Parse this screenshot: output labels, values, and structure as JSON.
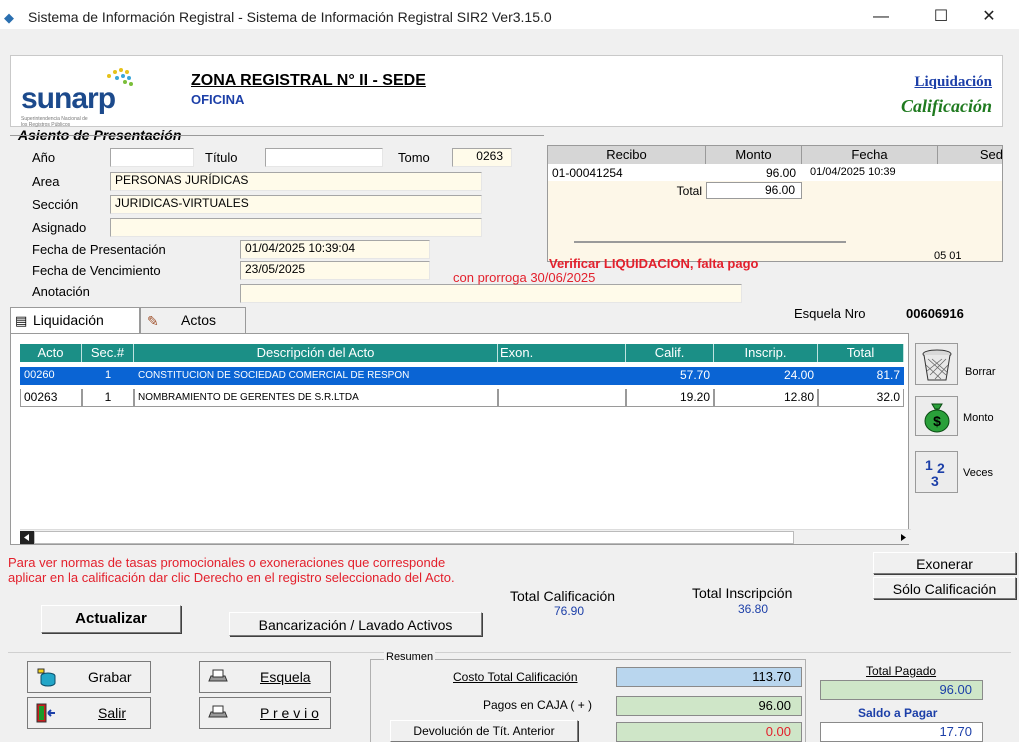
{
  "window": {
    "title": "Sistema de Información Registral - Sistema de Información Registral SIR2  Ver3.15.0",
    "minimize": "—",
    "maximize": "☐",
    "close": "✕"
  },
  "header": {
    "logo": "sunarp",
    "logo_sub": "Superintendencia Nacional de los Registros Públicos",
    "zona": "ZONA REGISTRAL N° II - SEDE",
    "oficina": "OFICINA",
    "liquidacion": "Liquidación",
    "calificacion": "Calificación"
  },
  "asiento": {
    "title": "Asiento de Presentación",
    "anio_label": "Año",
    "anio_value": "",
    "titulo_label": "Título",
    "titulo_value": "",
    "tomo_label": "Tomo",
    "tomo_value": "0263",
    "area_label": "Area",
    "area_value": "PERSONAS JURÍDICAS",
    "seccion_label": "Sección",
    "seccion_value": "JURIDICAS-VIRTUALES",
    "asignado_label": "Asignado",
    "asignado_value": "",
    "fecha_pres_label": "Fecha de Presentación",
    "fecha_pres_value": "01/04/2025 10:39:04",
    "fecha_venc_label": "Fecha de Vencimiento",
    "fecha_venc_value": "23/05/2025",
    "anotacion_label": "Anotación",
    "anotacion_value": ""
  },
  "recibos": {
    "headers": [
      "Recibo",
      "Monto",
      "Fecha",
      "Sed"
    ],
    "row": {
      "recibo": "01-00041254",
      "monto": "96.00",
      "fecha": "01/04/2025 10:39"
    },
    "total_label": "Total",
    "total_value": "96.00",
    "code": "05 01"
  },
  "warning": "Verificar LIQUIDACION,  falta pago",
  "prorroga": "con prorroga 30/06/2025",
  "tabs": {
    "liquidacion": "Liquidación",
    "actos": "Actos"
  },
  "esquela": {
    "label": "Esquela Nro",
    "value": "00606916"
  },
  "grid": {
    "headers": [
      "Acto",
      "Sec.#",
      "Descripción del Acto",
      "Exon.",
      "Calif.",
      "Inscrip.",
      "Total"
    ],
    "rows": [
      {
        "acto": "00260",
        "sec": "1",
        "desc": "CONSTITUCION DE SOCIEDAD COMERCIAL DE RESPON",
        "exon": "",
        "calif": "57.70",
        "inscrip": "24.00",
        "total": "81.7"
      },
      {
        "acto": "00263",
        "sec": "1",
        "desc": "NOMBRAMIENTO DE GERENTES DE S.R.LTDA",
        "exon": "",
        "calif": "19.20",
        "inscrip": "12.80",
        "total": "32.0"
      }
    ]
  },
  "side_buttons": {
    "borrar": "Borrar",
    "monto": "Monto",
    "veces": "Veces"
  },
  "notes": "Para ver normas de tasas promocionales o exoneraciones que corresponde aplicar en la calificación dar clic Derecho en el registro seleccionado del Acto.",
  "totals": {
    "calif_label": "Total Calificación",
    "calif_value": "76.90",
    "inscr_label": "Total Inscripción",
    "inscr_value": "36.80"
  },
  "buttons": {
    "exonerar": "Exonerar",
    "solo": "Sólo Calificación",
    "actualizar": "Actualizar",
    "bancarizacion": "Bancarización / Lavado Activos",
    "grabar": "Grabar",
    "salir": "Salir",
    "esquela": "Esquela",
    "previo": "P r e v i o"
  },
  "resumen": {
    "title": "Resumen",
    "costo_label": "Costo Total Calificación",
    "costo_value": "113.70",
    "pagos_label": "Pagos en CAJA  ( + )",
    "pagos_value": "96.00",
    "devol_label": "Devolución de Tít. Anterior",
    "devol_value": "0.00",
    "total_pagado_label": "Total Pagado",
    "total_pagado_value": "96.00",
    "saldo_label": "Saldo a Pagar",
    "saldo_value": "17.70"
  }
}
